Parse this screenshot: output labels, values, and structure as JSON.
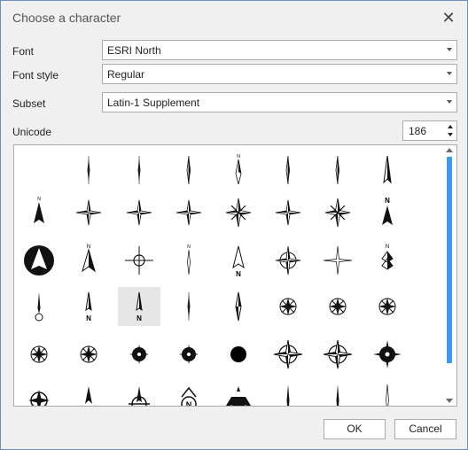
{
  "dialog": {
    "title": "Choose a character",
    "close_icon": "close-icon"
  },
  "fields": {
    "font": {
      "label": "Font",
      "value": "ESRI North"
    },
    "font_style": {
      "label": "Font style",
      "value": "Regular"
    },
    "subset": {
      "label": "Subset",
      "value": "Latin-1 Supplement"
    },
    "unicode": {
      "label": "Unicode",
      "value": "186"
    }
  },
  "grid": {
    "selected_row": 3,
    "selected_col": 2,
    "rows": [
      [
        "blank",
        "needle-thin",
        "needle-thin",
        "needle-half-dark",
        "needle-tall-n",
        "needle-half-dark",
        "needle-half-dark",
        "needle-wide"
      ],
      [
        "arrow-filled-n",
        "star-4-nsew",
        "star-4-nsew",
        "star-4-nsew",
        "star-8-nsew",
        "star-4-nsew",
        "star-8-nsew",
        "arrow-n-label"
      ],
      [
        "circle-arrow",
        "arrow-outline-n",
        "crosshair-circle",
        "needle-n-thin",
        "arrow-outline-n-below",
        "compass-rose-nsew",
        "star-4-light-nsew",
        "stack-n"
      ],
      [
        "needle-circle",
        "needle-n-letter",
        "needle-n-letter",
        "needle-thin",
        "needle-diamond",
        "compass-rose-small",
        "compass-rose-small",
        "compass-rose-small"
      ],
      [
        "compass-rose-small",
        "compass-rose-small",
        "compass-rose-dark",
        "compass-rose-dark",
        "dot-filled",
        "compass-rose-large",
        "compass-rose-large",
        "compass-rose-dark-large"
      ],
      [
        "ornate-rose",
        "ornate-needle",
        "ornate-arrow",
        "ornate-n-badge",
        "ornate-vehicle",
        "needle-thin-tall",
        "needle-thin-tall",
        "needle-tn"
      ]
    ]
  },
  "buttons": {
    "ok": "OK",
    "cancel": "Cancel"
  }
}
